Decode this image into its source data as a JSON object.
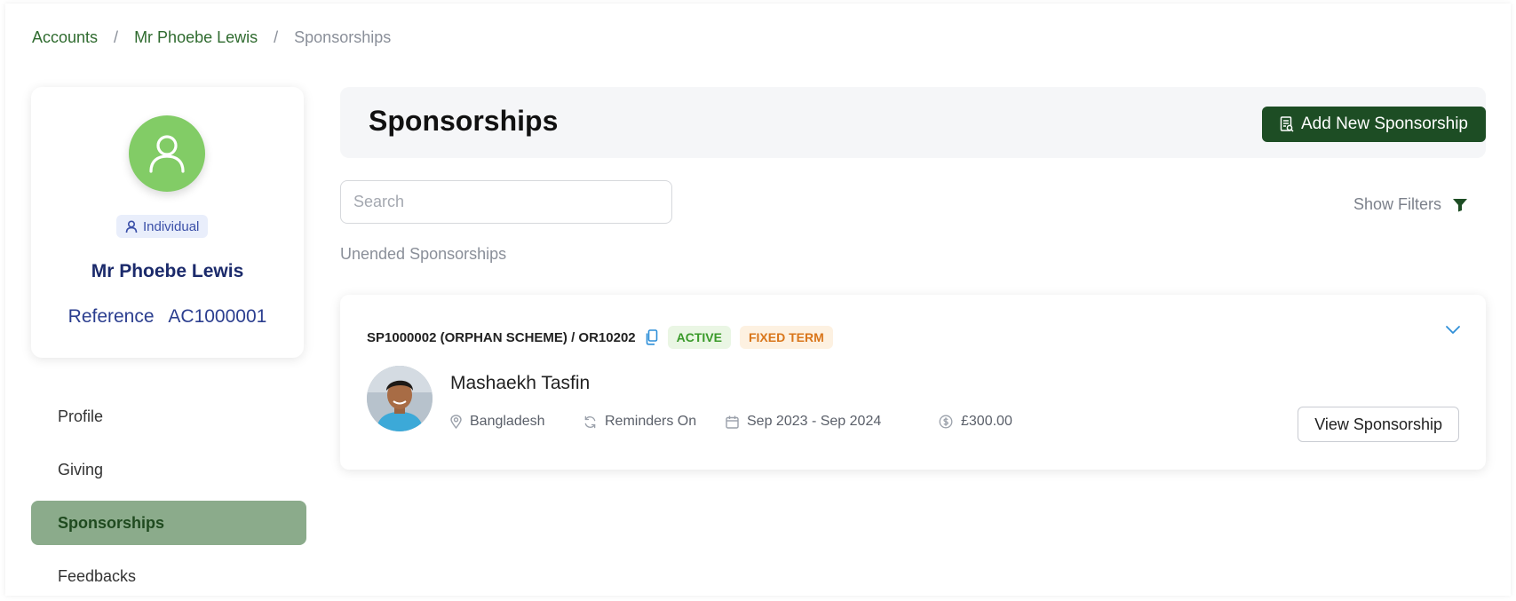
{
  "breadcrumb": {
    "items": [
      "Accounts",
      "Mr Phoebe Lewis",
      "Sponsorships"
    ],
    "separator": "/"
  },
  "profile": {
    "avatar_icon": "user-icon",
    "type_label": "Individual",
    "name": "Mr Phoebe Lewis",
    "reference_label": "Reference",
    "reference_value": "AC1000001"
  },
  "sidebar": {
    "items": [
      {
        "label": "Profile",
        "active": false
      },
      {
        "label": "Giving",
        "active": false
      },
      {
        "label": "Sponsorships",
        "active": true
      },
      {
        "label": "Feedbacks",
        "active": false
      }
    ]
  },
  "main": {
    "title": "Sponsorships",
    "add_button_label": "Add New Sponsorship",
    "search_placeholder": "Search",
    "filters_label": "Show Filters",
    "section_label": "Unended Sponsorships"
  },
  "sponsorship": {
    "reference": "SP1000002 (ORPHAN SCHEME) / OR10202",
    "status_badge": "ACTIVE",
    "term_badge": "FIXED TERM",
    "child_name": "Mashaekh Tasfin",
    "country": "Bangladesh",
    "reminders": "Reminders On",
    "period": "Sep 2023 - Sep 2024",
    "amount": "£300.00",
    "view_button_label": "View Sponsorship"
  },
  "colors": {
    "brand_dark_green": "#1d4d24",
    "link_green": "#2f6b2f",
    "avatar_green": "#82cc66",
    "active_nav_bg": "#8bab8b",
    "active_badge_text": "#3a9a2a",
    "fixed_badge_text": "#d9761b",
    "name_navy": "#1b2a6b"
  }
}
